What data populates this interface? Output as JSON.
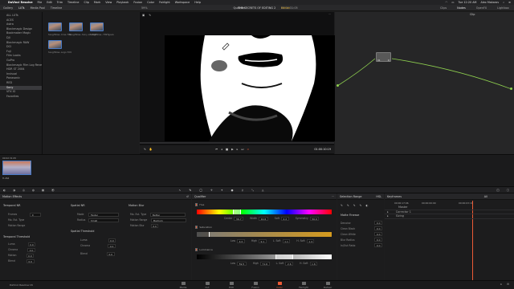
{
  "macos": {
    "apple": "",
    "app_name": "DaVinci Resolve",
    "menus": [
      "File",
      "Edit",
      "Trim",
      "Timeline",
      "Clip",
      "Mark",
      "View",
      "Playback",
      "Fusion",
      "Color",
      "Fairlight",
      "Workspace",
      "Help"
    ],
    "clock": "Tue 12:20 AM",
    "user": "Alex Makarov"
  },
  "toolbar": {
    "left_tabs": [
      "Gallery",
      "LUTs",
      "Media Pool",
      "Timeline"
    ],
    "zoom": "59%",
    "viewer_title": "Qualifier",
    "project": "THE SECRETS OF EDITING 2",
    "status": "Edited",
    "timecode": "00:02:31:05",
    "right_tabs": [
      "Clips",
      "Nodes",
      "OpenFX",
      "Lightbox"
    ],
    "clip_label": "Clip"
  },
  "media_tree": {
    "items": [
      "ALL LUTs",
      "ACES",
      "Astra",
      "Blackmagic Design",
      "Bookmaker Magic",
      "DJI",
      "Blackmagic RAW",
      "DCI",
      "Fuji",
      "Film Looks",
      "GoPro",
      "Blackmagic Film Log Reverse",
      "HDR ST 2084",
      "Invisual",
      "Panasonic",
      "RED",
      "Sony",
      "VFX IO",
      "Favorites"
    ],
    "selected_index": 16
  },
  "thumbs": [
    {
      "label": "SLog3SGa..Cine.709"
    },
    {
      "label": "SLog3SGa..Sony LC-709"
    },
    {
      "label": "SLog3SGa..709TypeA"
    },
    {
      "label": "SLog3SGa..Logo.709"
    }
  ],
  "viewer": {
    "timecode": "01:00:10:19",
    "transport": [
      "skip-start",
      "step-back",
      "stop",
      "play",
      "step-forward",
      "skip-end",
      "loop"
    ]
  },
  "nodes": {
    "node_label": "01",
    "node_subtitle": "Q"
  },
  "clip": {
    "timecode": "00:02:31:05",
    "track": "V1",
    "codec": "H.264"
  },
  "motion_effects": {
    "title": "Motion Effects",
    "temporal_nr": "Temporal NR",
    "frames_label": "Frames",
    "frames_value": "0",
    "mo_est_type": "Mo. Est. Type",
    "motion_range": "Motion Range",
    "temporal_threshold": "Temporal Threshold",
    "luma_label": "Luma",
    "chroma_label": "Chroma",
    "motion_label": "Motion",
    "blend_label": "Blend",
    "zero": "0.0"
  },
  "spatial_nr": {
    "title": "Spatial NR",
    "mode_label": "Mode",
    "mode_value": "Faster",
    "radius_label": "Radius",
    "radius_value": "Small",
    "threshold_title": "Spatial Threshold",
    "luma_label": "Luma",
    "chroma_label": "Chroma",
    "blend_label": "Blend",
    "zero": "0.0"
  },
  "motion_blur": {
    "title": "Motion Blur",
    "type_label": "Mo. Est. Type",
    "type_value": "Better",
    "range_label": "Motion Range",
    "range_value": "Medium",
    "blur_label": "Motion Blur",
    "blur_value": "0.0"
  },
  "qualifier": {
    "title": "Qualifier",
    "hue": {
      "label": "Hue",
      "center": "36.7",
      "width": "10.6",
      "soft": "2.2",
      "sym": "50.0",
      "center_label": "Center",
      "width_label": "Width",
      "soft_label": "Soft",
      "sym_label": "Symmetry"
    },
    "saturation": {
      "label": "Saturation",
      "low": "4.0",
      "high": "9.1",
      "lsoft": "1.1",
      "hsoft": "1.4",
      "low_label": "Low",
      "high_label": "High",
      "lsoft_label": "L. Soft",
      "hsoft_label": "H. Soft"
    },
    "luminance": {
      "label": "Luminance",
      "low": "59.5",
      "high": "71.6",
      "lsoft": "2.6",
      "hsoft": "1.6",
      "low_label": "Low",
      "high_label": "High",
      "lsoft_label": "L. Soft",
      "hsoft_label": "H. Soft"
    }
  },
  "selection_range": {
    "title": "Selection Range",
    "matte_finesse": "Matte Finesse",
    "items": [
      "Denoise",
      "Clean Black",
      "Clean White",
      "Blur Radius",
      "In/Out Ratio"
    ],
    "values": [
      "0.0",
      "0.0",
      "0.0",
      "0.0",
      "0.0"
    ],
    "hsl": "HSL"
  },
  "keyframes": {
    "title": "Keyframes",
    "filter": "All",
    "timecodes": [
      "00:00:17:06",
      "00:00:00:00",
      "00:00:03:16"
    ],
    "rows": [
      "Master",
      "Corrector 1",
      "Sizing"
    ]
  },
  "pages": [
    {
      "label": "Media"
    },
    {
      "label": "Cut"
    },
    {
      "label": "Edit"
    },
    {
      "label": "Fusion"
    },
    {
      "label": "Color"
    },
    {
      "label": "Fairlight"
    },
    {
      "label": "Deliver"
    }
  ],
  "active_page": "Color",
  "bottom_left": "DaVinci Resolve 16",
  "colors": {
    "accent": "#ec5a35",
    "selection": "#4a7bc6",
    "node_line": "#8fd14f"
  }
}
